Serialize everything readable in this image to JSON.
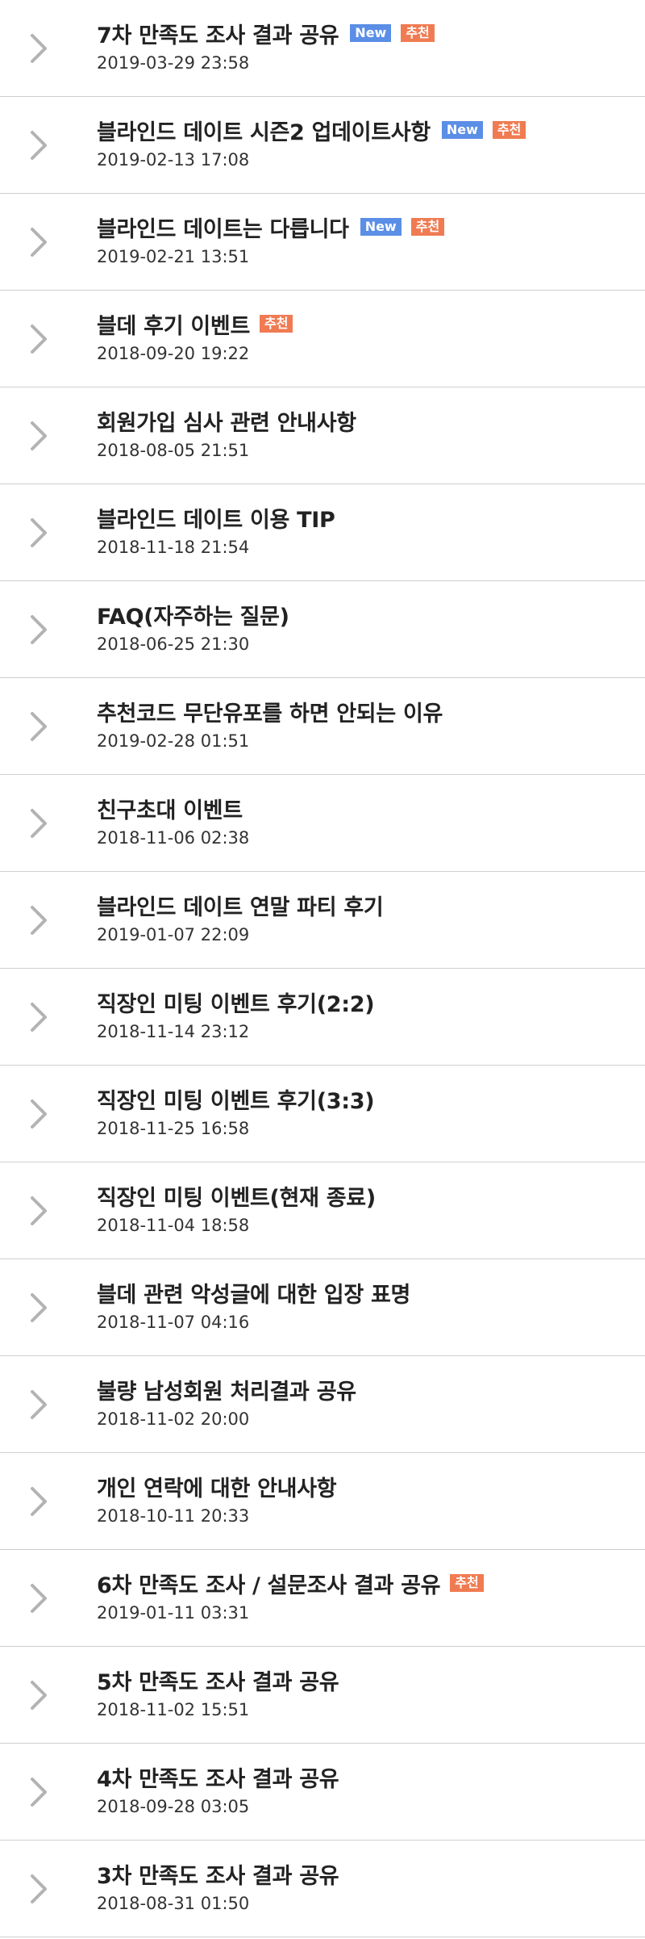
{
  "badges": {
    "new_label": "New",
    "rec_label": "추천"
  },
  "colors": {
    "new_badge": "#5b8ee6",
    "rec_badge": "#f07b52",
    "divider": "#cfcfcf",
    "chevron": "#b3b3b3",
    "text": "#222222"
  },
  "icons": {
    "row_arrow": "chevron-right-icon"
  },
  "items": [
    {
      "title": "7차 만족도 조사 결과 공유",
      "date": "2019-03-29 23:58",
      "new": true,
      "rec": true
    },
    {
      "title": "블라인드 데이트 시즌2 업데이트사항",
      "date": "2019-02-13 17:08",
      "new": true,
      "rec": true
    },
    {
      "title": "블라인드 데이트는 다릅니다",
      "date": "2019-02-21 13:51",
      "new": true,
      "rec": true
    },
    {
      "title": "블데 후기 이벤트",
      "date": "2018-09-20 19:22",
      "new": false,
      "rec": true
    },
    {
      "title": "회원가입 심사 관련 안내사항",
      "date": "2018-08-05 21:51",
      "new": false,
      "rec": false
    },
    {
      "title": "블라인드 데이트 이용 TIP",
      "date": "2018-11-18 21:54",
      "new": false,
      "rec": false
    },
    {
      "title": "FAQ(자주하는 질문)",
      "date": "2018-06-25 21:30",
      "new": false,
      "rec": false
    },
    {
      "title": "추천코드 무단유포를 하면 안되는 이유",
      "date": "2019-02-28 01:51",
      "new": false,
      "rec": false
    },
    {
      "title": "친구초대 이벤트",
      "date": "2018-11-06 02:38",
      "new": false,
      "rec": false
    },
    {
      "title": "블라인드 데이트 연말 파티 후기",
      "date": "2019-01-07 22:09",
      "new": false,
      "rec": false
    },
    {
      "title": "직장인 미팅 이벤트 후기(2:2)",
      "date": "2018-11-14 23:12",
      "new": false,
      "rec": false
    },
    {
      "title": "직장인 미팅 이벤트 후기(3:3)",
      "date": "2018-11-25 16:58",
      "new": false,
      "rec": false
    },
    {
      "title": "직장인 미팅 이벤트(현재 종료)",
      "date": "2018-11-04 18:58",
      "new": false,
      "rec": false
    },
    {
      "title": "블데 관련 악성글에 대한 입장 표명",
      "date": "2018-11-07 04:16",
      "new": false,
      "rec": false
    },
    {
      "title": "불량 남성회원 처리결과 공유",
      "date": "2018-11-02 20:00",
      "new": false,
      "rec": false
    },
    {
      "title": "개인 연락에 대한 안내사항",
      "date": "2018-10-11 20:33",
      "new": false,
      "rec": false
    },
    {
      "title": "6차 만족도 조사 / 설문조사 결과 공유",
      "date": "2019-01-11 03:31",
      "new": false,
      "rec": true
    },
    {
      "title": "5차 만족도 조사 결과 공유",
      "date": "2018-11-02 15:51",
      "new": false,
      "rec": false
    },
    {
      "title": "4차 만족도 조사 결과 공유",
      "date": "2018-09-28 03:05",
      "new": false,
      "rec": false
    },
    {
      "title": "3차 만족도 조사 결과 공유",
      "date": "2018-08-31 01:50",
      "new": false,
      "rec": false
    }
  ]
}
